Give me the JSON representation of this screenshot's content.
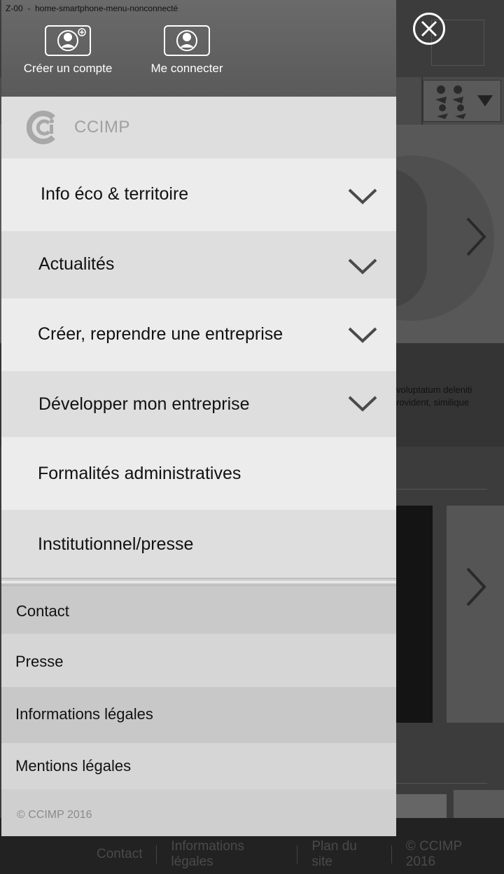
{
  "page_code": "Z-00  -  home-smartphone-menu-nonconnecté",
  "account": {
    "create_label": "Créer un compte",
    "login_label": "Me connecter"
  },
  "brand": {
    "name": "CCIMP",
    "logo_icon": "ccimp-logo-icon"
  },
  "menu": {
    "items": [
      {
        "label": "Info éco & territoire",
        "expandable": true
      },
      {
        "label": "Actualités",
        "expandable": true
      },
      {
        "label": "Créer, reprendre une entreprise",
        "expandable": true
      },
      {
        "label": "Développer mon entreprise",
        "expandable": true
      },
      {
        "label": "Formalités administratives",
        "expandable": false
      },
      {
        "label": "Institutionnel/presse",
        "expandable": false
      }
    ]
  },
  "secondary": {
    "items": [
      {
        "label": "Contact"
      },
      {
        "label": "Presse"
      },
      {
        "label": "Informations légales"
      },
      {
        "label": "Mentions légales"
      }
    ],
    "copyright": "© CCIMP 2016"
  },
  "background": {
    "news_line1": "voluptatum deleniti",
    "news_line2": "rovident, similique",
    "footer_links": [
      "Contact",
      "Informations légales",
      "Plan du site",
      "© CCIMP 2016"
    ]
  },
  "colors": {
    "drawer_header": "#606060",
    "menu_light": "#ececec",
    "menu_dark": "#dedede",
    "secondary_light": "#d6d6d6",
    "secondary_dark": "#c8c8c8",
    "chevron": "#4a4a4a"
  }
}
